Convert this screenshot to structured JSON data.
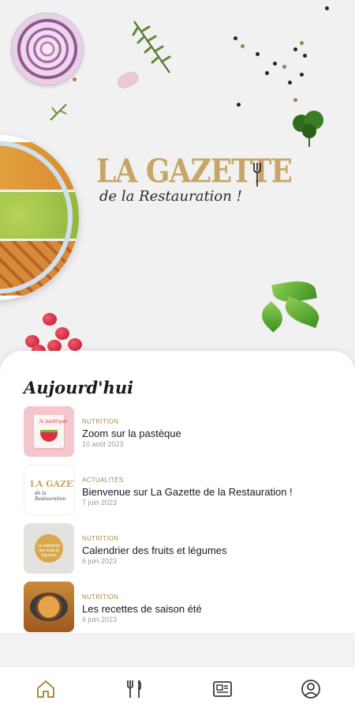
{
  "hero": {
    "logo": {
      "title": "LA GAZETTE",
      "subtitle": "de la Restauration !"
    }
  },
  "today": {
    "title": "Aujourd'hui",
    "articles": [
      {
        "category": "NUTRITION",
        "title": "Zoom sur la pastèque",
        "date": "10 août 2023",
        "thumb_text": "la pastèque"
      },
      {
        "category": "ACTUALITÉS",
        "title": "Bienvenue sur La Gazette de la Restauration !",
        "date": "7 juin 2023",
        "thumb_text": "LA GAZETTE",
        "thumb_sub": "de la Restauration"
      },
      {
        "category": "NUTRITION",
        "title": "Calendrier des fruits et légumes",
        "date": "6 juin 2023",
        "thumb_text": "Le calendrier des fruits & légumes"
      },
      {
        "category": "NUTRITION",
        "title": "Les recettes de saison été",
        "date": "6 juin 2023"
      }
    ]
  },
  "bottom_nav": {
    "items": [
      {
        "icon": "home-icon",
        "active": true
      },
      {
        "icon": "fork-knife-icon",
        "active": false
      },
      {
        "icon": "newspaper-icon",
        "active": false
      },
      {
        "icon": "profile-icon",
        "active": false
      }
    ],
    "active_color": "#b08a3e",
    "color": "#3a3a3a"
  }
}
